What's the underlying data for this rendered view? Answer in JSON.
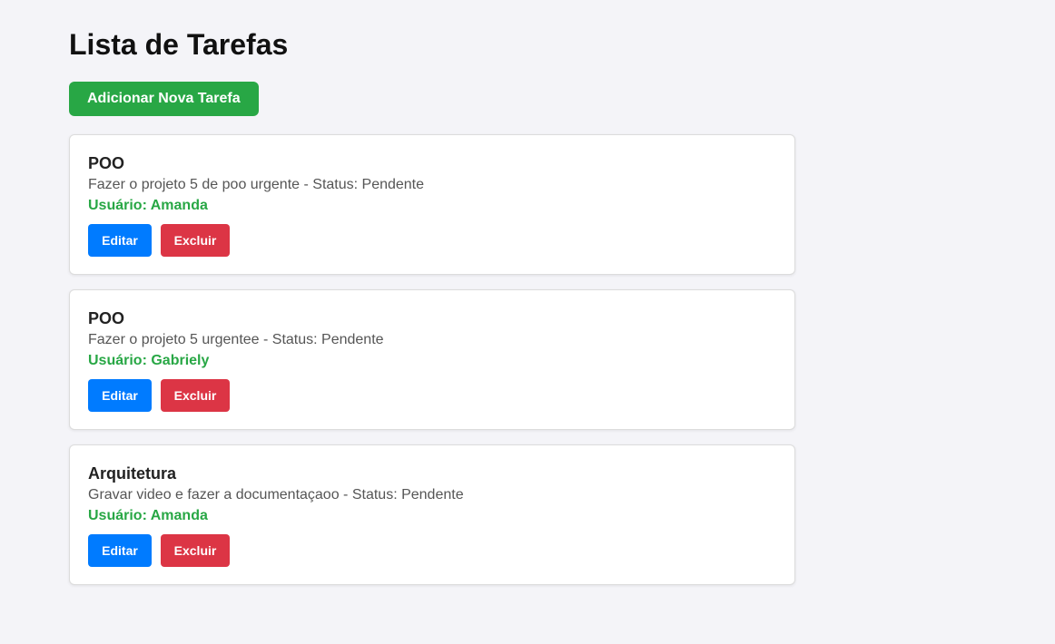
{
  "page": {
    "title": "Lista de Tarefas",
    "add_button_label": "Adicionar Nova Tarefa"
  },
  "tasks": [
    {
      "title": "POO",
      "description": "Fazer o projeto 5 de poo urgente",
      "status_text": "Status: Pendente",
      "user_text": "Usuário: Amanda",
      "edit_label": "Editar",
      "delete_label": "Excluir"
    },
    {
      "title": "POO",
      "description": "Fazer o projeto 5 urgentee",
      "status_text": "Status: Pendente",
      "user_text": "Usuário: Gabriely",
      "edit_label": "Editar",
      "delete_label": "Excluir"
    },
    {
      "title": "Arquitetura",
      "description": "Gravar video e fazer a documentaçaoo",
      "status_text": "Status: Pendente",
      "user_text": "Usuário: Amanda",
      "edit_label": "Editar",
      "delete_label": "Excluir"
    }
  ],
  "colors": {
    "background": "#f4f4f8",
    "add_button": "#28a745",
    "user_text": "#28a745",
    "edit_button": "#007bff",
    "delete_button": "#dc3545"
  }
}
